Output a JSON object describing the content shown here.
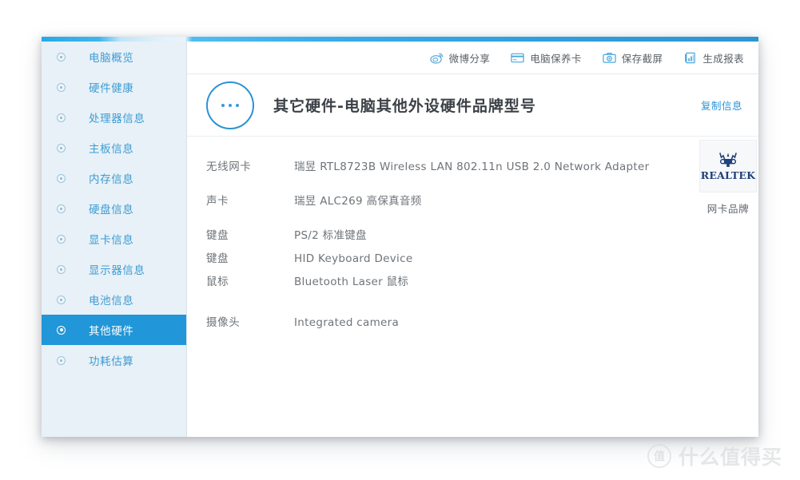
{
  "sidebar": {
    "items": [
      {
        "label": "电脑概览",
        "icon": "radio-dot-icon",
        "active": false
      },
      {
        "label": "硬件健康",
        "icon": "radio-dot-icon",
        "active": false
      },
      {
        "label": "处理器信息",
        "icon": "radio-dot-icon",
        "active": false
      },
      {
        "label": "主板信息",
        "icon": "radio-dot-icon",
        "active": false
      },
      {
        "label": "内存信息",
        "icon": "radio-dot-icon",
        "active": false
      },
      {
        "label": "硬盘信息",
        "icon": "radio-dot-icon",
        "active": false
      },
      {
        "label": "显卡信息",
        "icon": "radio-dot-icon",
        "active": false
      },
      {
        "label": "显示器信息",
        "icon": "radio-dot-icon",
        "active": false
      },
      {
        "label": "电池信息",
        "icon": "radio-dot-icon",
        "active": false
      },
      {
        "label": "其他硬件",
        "icon": "radio-dot-icon",
        "active": true
      },
      {
        "label": "功耗估算",
        "icon": "radio-dot-icon",
        "active": false
      }
    ]
  },
  "toolbar": {
    "buttons": [
      {
        "label": "微博分享",
        "icon": "weibo-icon"
      },
      {
        "label": "电脑保养卡",
        "icon": "card-icon"
      },
      {
        "label": "保存截屏",
        "icon": "camera-icon"
      },
      {
        "label": "生成报表",
        "icon": "report-icon"
      }
    ]
  },
  "header": {
    "avatar_icon": "three-dots-circle-icon",
    "title": "其它硬件-电脑其他外设硬件品牌型号",
    "copy_label": "复制信息"
  },
  "specs": [
    {
      "label": "无线网卡",
      "value": "瑞昱 RTL8723B Wireless LAN 802.11n USB 2.0 Network Adapter"
    },
    {
      "label": "声卡",
      "value": "瑞昱 ALC269 高保真音频"
    },
    {
      "label": "键盘",
      "value": "PS/2 标准键盘"
    },
    {
      "label": "键盘",
      "value": "HID Keyboard Device"
    },
    {
      "label": "鼠标",
      "value": "Bluetooth Laser 鼠标"
    },
    {
      "label": "摄像头",
      "value": "Integrated camera"
    }
  ],
  "brand": {
    "wordmark": "REALTEK",
    "caption": "网卡品牌",
    "logo_icon": "realtek-crest-icon"
  },
  "watermark": {
    "badge": "值",
    "text": "什么值得买"
  },
  "colors": {
    "accent": "#2196d8",
    "sidebar_bg": "#e8f1f7",
    "link": "#2a93d8",
    "text": "#6f7479",
    "brand_navy": "#21417c"
  }
}
